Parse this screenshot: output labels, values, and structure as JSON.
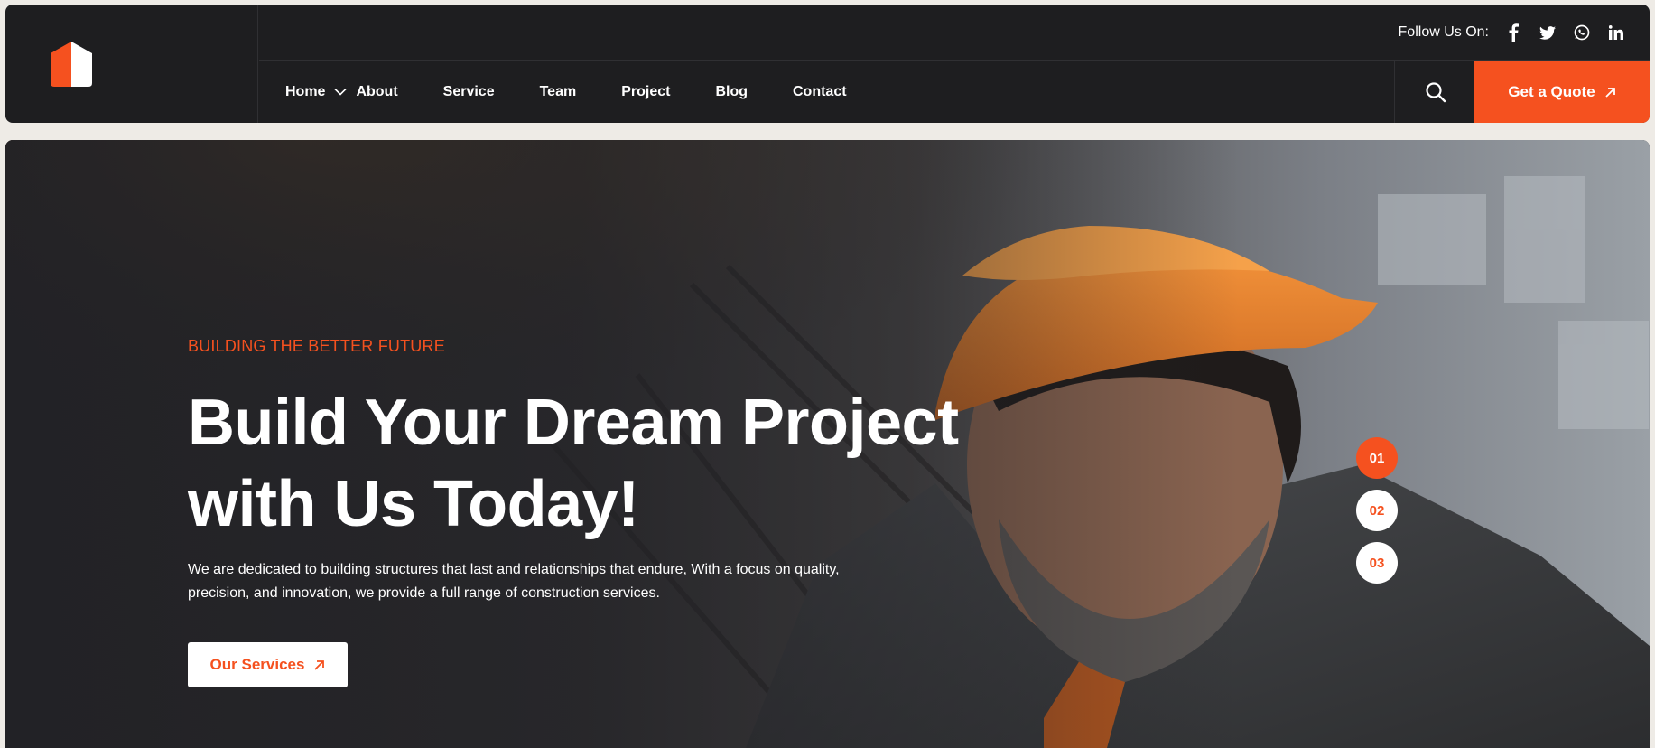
{
  "header": {
    "follow_label": "Follow Us On:",
    "social": [
      "facebook-icon",
      "twitter-icon",
      "whatsapp-icon",
      "linkedin-icon"
    ],
    "nav": [
      {
        "label": "Home",
        "has_dropdown": true
      },
      {
        "label": "About"
      },
      {
        "label": "Service"
      },
      {
        "label": "Team"
      },
      {
        "label": "Project"
      },
      {
        "label": "Blog"
      },
      {
        "label": "Contact"
      }
    ],
    "quote_label": "Get a Quote"
  },
  "hero": {
    "kicker": "BUILDING THE BETTER FUTURE",
    "headline_line1": "Build Your Dream Project",
    "headline_line2": "with Us Today!",
    "description": "We are dedicated to building structures that last and relationships that endure, With a focus on quality, precision, and innovation, we provide a full range of construction services.",
    "button_label": "Our Services",
    "slides": [
      "01",
      "02",
      "03"
    ],
    "active_slide": "01"
  },
  "colors": {
    "accent": "#f5511f",
    "header_bg": "#1e1e20",
    "page_bg": "#eeebe6"
  }
}
